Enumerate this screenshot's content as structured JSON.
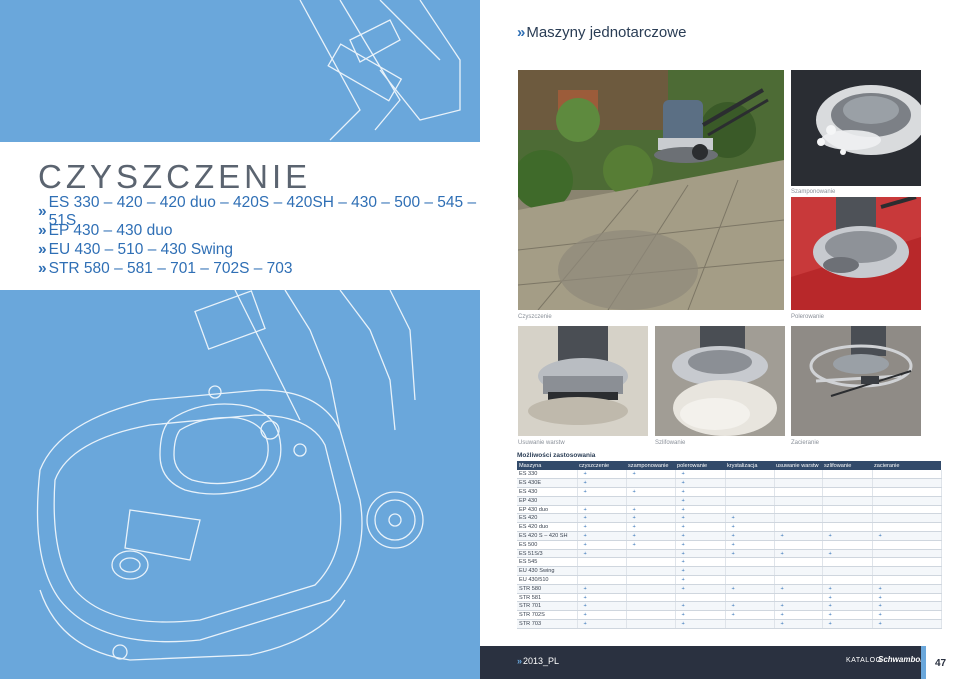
{
  "left": {
    "title": "CZYSZCZENIE",
    "models": [
      "ES 330 – 420 – 420 duo – 420S – 420SH – 430 – 500 – 545 – 51S",
      "EP 430 – 430 duo",
      "EU 430 – 510 – 430 Swing",
      "STR 580 – 581 – 701 – 702S – 703"
    ]
  },
  "right": {
    "section_title": "Maszyny jednotarczowe",
    "photos": [
      {
        "caption": "Czyszczenie",
        "icon": "floor-cleaning-photo"
      },
      {
        "caption": "Szamponowanie",
        "icon": "carpet-shampoo-photo"
      },
      {
        "caption": "Polerowanie",
        "icon": "polishing-photo"
      },
      {
        "caption": "Usuwanie warstw",
        "icon": "layer-removal-photo"
      },
      {
        "caption": "Szlifowanie",
        "icon": "grinding-photo"
      },
      {
        "caption": "Zacieranie",
        "icon": "troweling-photo"
      }
    ],
    "table": {
      "title": "Możliwości zastosowania",
      "columns": [
        "Maszyna",
        "czyszczenie",
        "szamponowanie",
        "polerowanie",
        "krystalizacja",
        "usuwanie warstw",
        "szlifowanie",
        "zacieranie"
      ],
      "rows": [
        [
          "ES 330",
          "+",
          "+",
          "+",
          "",
          "",
          "",
          ""
        ],
        [
          "ES 430E",
          "+",
          "",
          "+",
          "",
          "",
          "",
          ""
        ],
        [
          "ES 430",
          "+",
          "+",
          "+",
          "",
          "",
          "",
          ""
        ],
        [
          "EP 430",
          "",
          "",
          "+",
          "",
          "",
          "",
          ""
        ],
        [
          "EP 430 duo",
          "+",
          "+",
          "+",
          "",
          "",
          "",
          ""
        ],
        [
          "ES 420",
          "+",
          "+",
          "+",
          "+",
          "",
          "",
          ""
        ],
        [
          "ES 420 duo",
          "+",
          "+",
          "+",
          "+",
          "",
          "",
          ""
        ],
        [
          "ES 420 S – 420 SH",
          "+",
          "+",
          "+",
          "+",
          "+",
          "+",
          "+"
        ],
        [
          "ES 500",
          "+",
          "+",
          "+",
          "+",
          "",
          "",
          ""
        ],
        [
          "ES 51S/3",
          "+",
          "",
          "+",
          "+",
          "+",
          "+",
          ""
        ],
        [
          "ES 545",
          "",
          "",
          "+",
          "",
          "",
          "",
          ""
        ],
        [
          "EU 430 Swing",
          "",
          "",
          "+",
          "",
          "",
          "",
          ""
        ],
        [
          "EU 430/510",
          "",
          "",
          "+",
          "",
          "",
          "",
          ""
        ],
        [
          "STR 580",
          "+",
          "",
          "+",
          "+",
          "+",
          "+",
          "+"
        ],
        [
          "STR 581",
          "+",
          "",
          "",
          "",
          "",
          "+",
          "+"
        ],
        [
          "STR 701",
          "+",
          "",
          "+",
          "+",
          "+",
          "+",
          "+"
        ],
        [
          "STR 702S",
          "+",
          "",
          "+",
          "+",
          "+",
          "+",
          "+"
        ],
        [
          "STR 703",
          "+",
          "",
          "+",
          "",
          "+",
          "+",
          "+"
        ]
      ]
    }
  },
  "footer": {
    "year": "2013_PL",
    "catalog": "KATALOG",
    "brand": "Schwamborn",
    "page": "47"
  },
  "colors": {
    "left_bg": "#6aa7db",
    "accent": "#2f6fb5",
    "table_header": "#324a6a",
    "footer_bg": "#2a3140"
  }
}
